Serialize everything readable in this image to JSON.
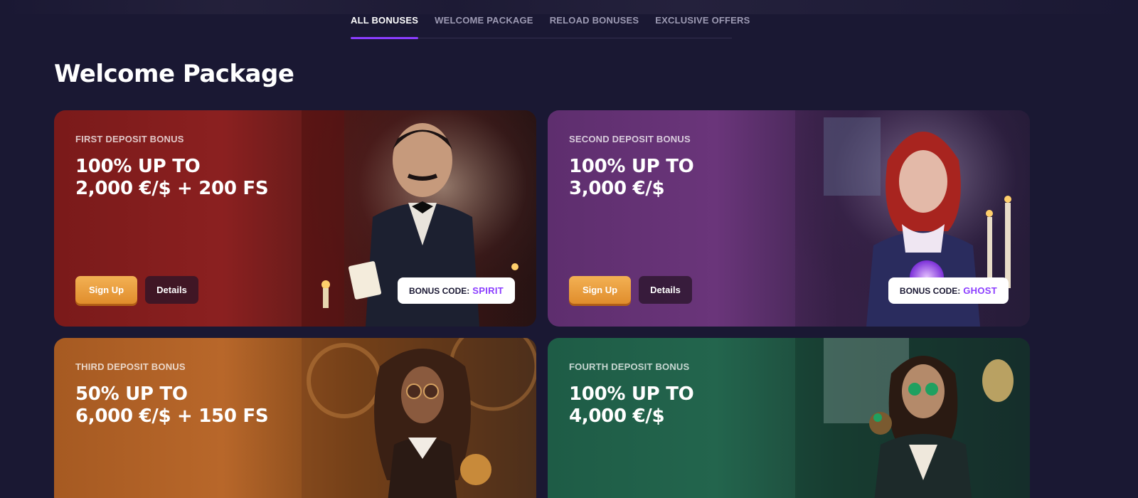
{
  "tabs": [
    {
      "label": "ALL BONUSES",
      "active": true
    },
    {
      "label": "WELCOME PACKAGE",
      "active": false
    },
    {
      "label": "RELOAD BONUSES",
      "active": false
    },
    {
      "label": "EXCLUSIVE OFFERS",
      "active": false
    }
  ],
  "section": {
    "title": "Welcome Package"
  },
  "cards": [
    {
      "label": "FIRST DEPOSIT BONUS",
      "headline_line1": "100% UP TO",
      "headline_line2": "2,000 €/$ + 200 FS",
      "signup_label": "Sign Up",
      "details_label": "Details",
      "code_prefix": "BONUS CODE:",
      "code": "SPIRIT"
    },
    {
      "label": "SECOND DEPOSIT BONUS",
      "headline_line1": "100% UP TO",
      "headline_line2": "3,000 €/$",
      "signup_label": "Sign Up",
      "details_label": "Details",
      "code_prefix": "BONUS CODE:",
      "code": "GHOST"
    },
    {
      "label": "THIRD DEPOSIT BONUS",
      "headline_line1": "50% UP TO",
      "headline_line2": "6,000 €/$ + 150 FS"
    },
    {
      "label": "FOURTH DEPOSIT BONUS",
      "headline_line1": "100% UP TO",
      "headline_line2": "4,000 €/$"
    }
  ],
  "colors": {
    "background": "#1a1833",
    "accent": "#8b3dff",
    "signup_button": "#e8a040"
  }
}
